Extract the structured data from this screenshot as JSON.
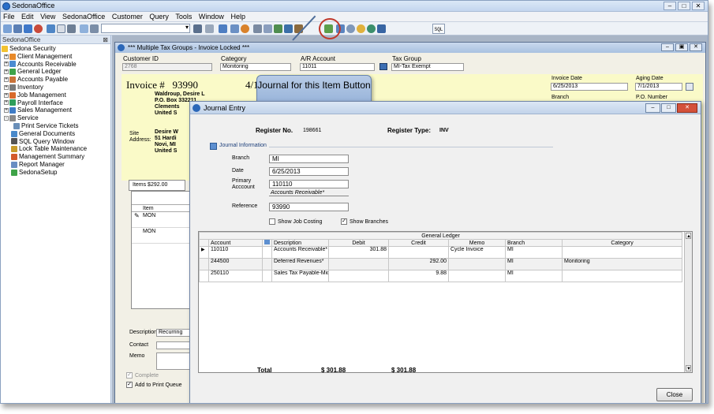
{
  "app": {
    "title": "SedonaOffice",
    "menu": [
      "File",
      "Edit",
      "View",
      "SedonaOffice",
      "Customer",
      "Query",
      "Tools",
      "Window",
      "Help"
    ],
    "toolbar_sql": "SQL"
  },
  "sidebar": {
    "header": "SedonaOffice",
    "items": [
      {
        "label": "Sedona Security",
        "level": 0,
        "expand": ""
      },
      {
        "label": "Client Management",
        "level": 1,
        "expand": "+"
      },
      {
        "label": "Accounts Receivable",
        "level": 1,
        "expand": "+"
      },
      {
        "label": "General Ledger",
        "level": 1,
        "expand": "+"
      },
      {
        "label": "Accounts Payable",
        "level": 1,
        "expand": "+"
      },
      {
        "label": "Inventory",
        "level": 1,
        "expand": "+"
      },
      {
        "label": "Job Management",
        "level": 1,
        "expand": "+"
      },
      {
        "label": "Payroll Interface",
        "level": 1,
        "expand": "+"
      },
      {
        "label": "Sales Management",
        "level": 1,
        "expand": "+"
      },
      {
        "label": "Service",
        "level": 1,
        "expand": "-"
      },
      {
        "label": "Print Service Tickets",
        "level": 2,
        "expand": ""
      },
      {
        "label": "General Documents",
        "level": 1,
        "expand": ""
      },
      {
        "label": "SQL Query Window",
        "level": 1,
        "expand": ""
      },
      {
        "label": "Lock Table Maintenance",
        "level": 1,
        "expand": ""
      },
      {
        "label": "Management Summary",
        "level": 1,
        "expand": ""
      },
      {
        "label": "Report Manager",
        "level": 1,
        "expand": ""
      },
      {
        "label": "SedonaSetup",
        "level": 1,
        "expand": ""
      }
    ]
  },
  "invoice_window": {
    "title": "*** Multiple Tax Groups - Invoice Locked ***",
    "customer_id_label": "Customer ID",
    "customer_id": "2768",
    "category_label": "Category",
    "category": "Monitoring",
    "ar_account_label": "A/R Account",
    "ar_account": "11011",
    "tax_group_label": "Tax Group",
    "tax_group": "MI-Tax Exempt",
    "invoice_label": "Invoice #",
    "invoice_number": "93990",
    "invoice_date_prefix": "4/1",
    "invoice_date_label": "Invoice Date",
    "invoice_date": "6/25/2013",
    "aging_date_label": "Aging Date",
    "aging_date": "7/1/2013",
    "branch_label": "Branch",
    "po_label": "P.O. Number",
    "bill_to": [
      "Waldroup, Desire L",
      "P.O. Box 332211",
      "Clements",
      "United S"
    ],
    "site_label": "Site Address:",
    "site": [
      "Desire W",
      "51 Hardi",
      "Novi, MI",
      "United S"
    ],
    "items_tab": "Items  $292.00",
    "item_header": "Item",
    "items": [
      "MON",
      "MON"
    ],
    "description_label": "Description",
    "description": "Recurring",
    "contact_label": "Contact",
    "memo_label": "Memo",
    "complete_label": "Complete",
    "print_queue_label": "Add to Print Queue"
  },
  "callout": {
    "text": "Journal for this Item Button"
  },
  "journal": {
    "title": "Journal Entry",
    "register_no_label": "Register No.",
    "register_no": "198661",
    "register_type_label": "Register Type:",
    "register_type": "INV",
    "section_label": "Journal Information",
    "branch_label": "Branch",
    "branch": "MI",
    "date_label": "Date",
    "date": "6/25/2013",
    "primary_label_1": "Primary",
    "primary_label_2": "Acccount",
    "primary_account": "110110",
    "primary_account_name": "Accounts Receivable*",
    "reference_label": "Reference",
    "reference": "93990",
    "show_job_costing": "Show Job Costing",
    "show_branches": "Show Branches",
    "gl_group": "General Ledger",
    "columns": [
      "Account",
      "Description",
      "Debit",
      "Credit",
      "Memo",
      "Branch",
      "Category"
    ],
    "rows": [
      {
        "account": "110110",
        "description": "Accounts Receivable*",
        "debit": "301.88",
        "credit": "",
        "memo": "Cycle Invoice",
        "branch": "MI",
        "category": ""
      },
      {
        "account": "244500",
        "description": "Deferred Revenues*",
        "debit": "",
        "credit": "292.00",
        "memo": "",
        "branch": "MI",
        "category": "Monitoring"
      },
      {
        "account": "250110",
        "description": "Sales Tax Payable-Mict",
        "debit": "",
        "credit": "9.88",
        "memo": "",
        "branch": "MI",
        "category": ""
      }
    ],
    "total_label": "Total",
    "total_debit": "$ 301.88",
    "total_credit": "$ 301.88",
    "close_label": "Close"
  }
}
